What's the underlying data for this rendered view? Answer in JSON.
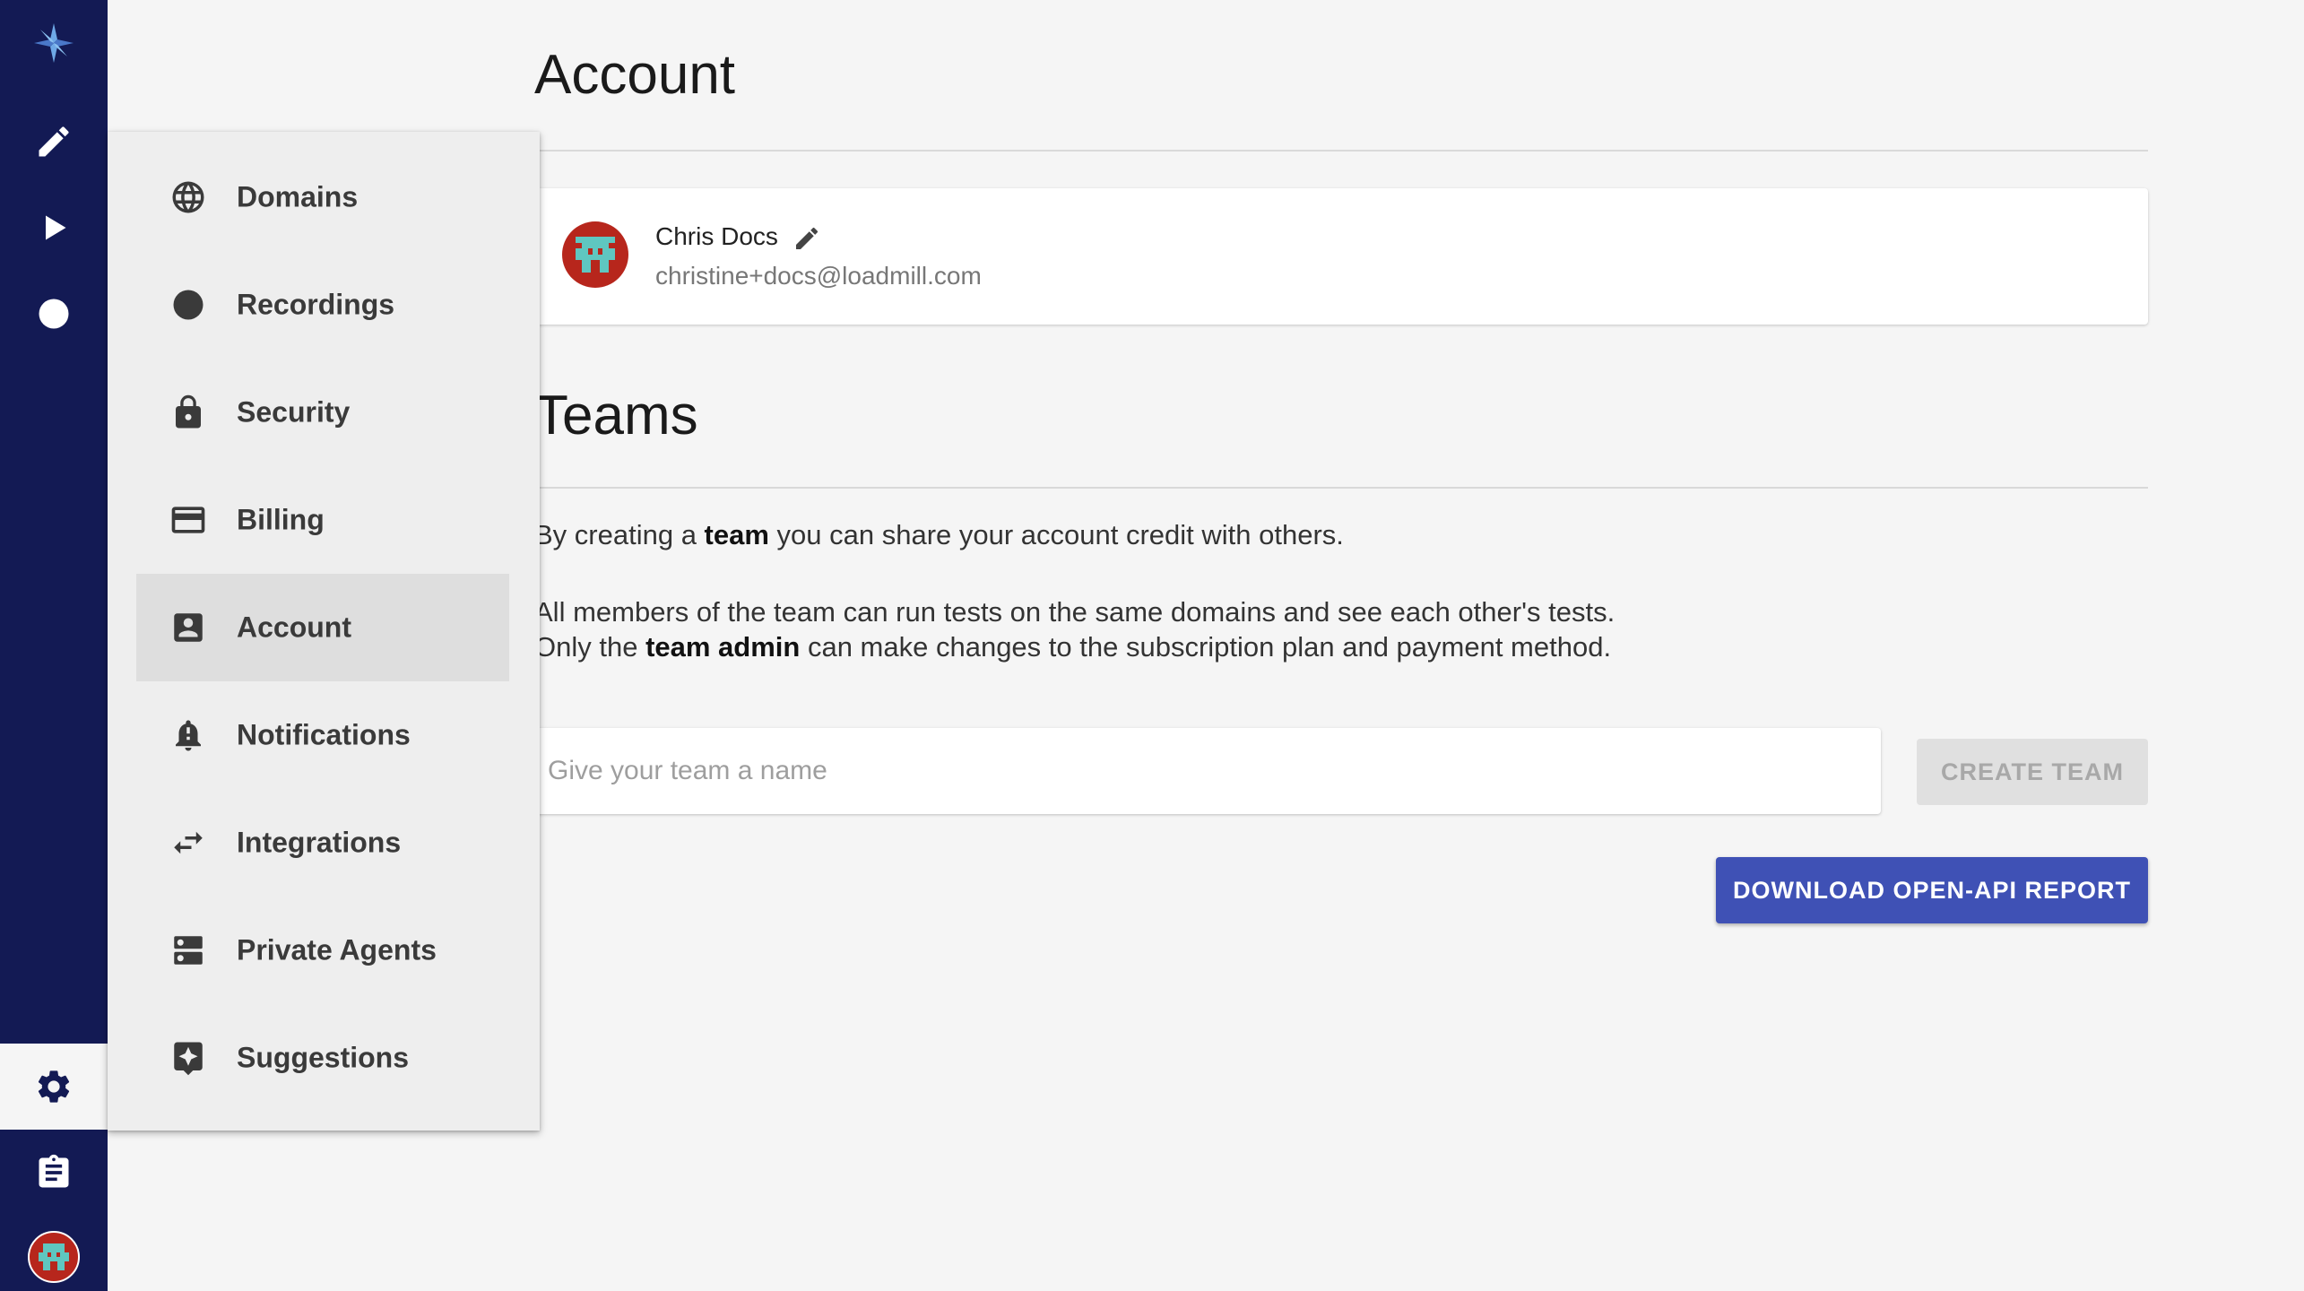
{
  "rail": {
    "icons": [
      "logo-icon",
      "pencil-icon",
      "play-icon",
      "record-dot-icon",
      "gear-icon",
      "clipboard-icon",
      "user-avatar"
    ],
    "active": "gear-icon"
  },
  "settings_menu": {
    "items": [
      {
        "label": "Domains",
        "icon": "globe-icon"
      },
      {
        "label": "Recordings",
        "icon": "record-dot-icon"
      },
      {
        "label": "Security",
        "icon": "lock-icon"
      },
      {
        "label": "Billing",
        "icon": "credit-card-icon"
      },
      {
        "label": "Account",
        "icon": "account-box-icon",
        "selected": true
      },
      {
        "label": "Notifications",
        "icon": "bell-icon"
      },
      {
        "label": "Integrations",
        "icon": "swap-arrows-icon"
      },
      {
        "label": "Private Agents",
        "icon": "server-icon"
      },
      {
        "label": "Suggestions",
        "icon": "sparkle-icon"
      }
    ]
  },
  "account": {
    "title": "Account",
    "user": {
      "name": "Chris Docs",
      "email": "christine+docs@loadmill.com"
    }
  },
  "teams": {
    "title": "Teams",
    "line1": {
      "pre": "By creating a ",
      "bold": "team",
      "post": " you can share your account credit with others."
    },
    "line2": "All members of the team can run tests on the same domains and see each other's tests.",
    "line3": {
      "pre": "Only the ",
      "bold": "team admin",
      "post": " can make changes to the subscription plan and payment method."
    },
    "input_placeholder": "Give your team a name",
    "input_value": "",
    "create_button": "CREATE TEAM"
  },
  "download_button": "DOWNLOAD OPEN-API REPORT",
  "colors": {
    "rail": "#131a54",
    "primary": "#3f51b5",
    "avatar_red": "#b7261c",
    "avatar_teal": "#5fc6c0"
  }
}
